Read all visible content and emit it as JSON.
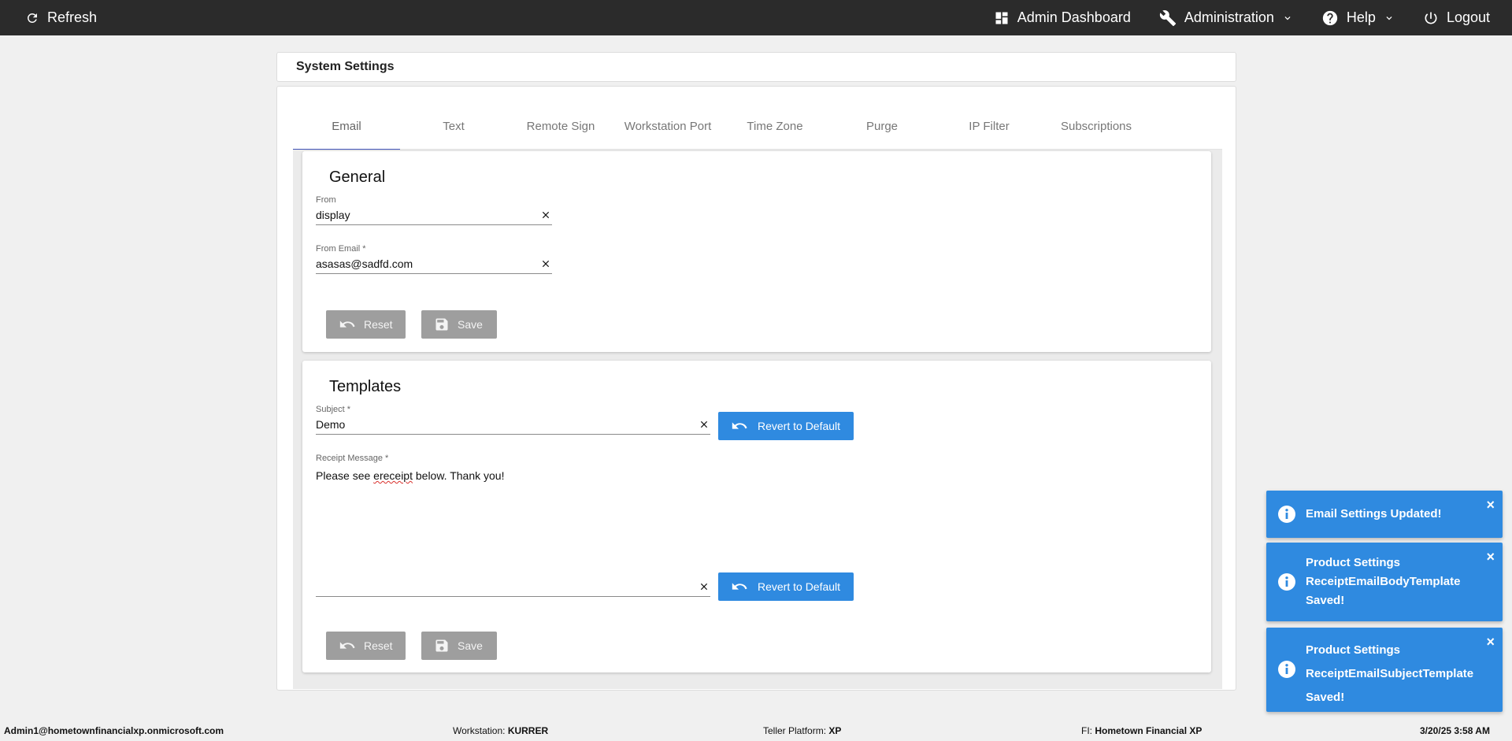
{
  "topbar": {
    "refresh_label": "Refresh",
    "admin_dashboard_label": "Admin Dashboard",
    "administration_label": "Administration",
    "help_label": "Help",
    "logout_label": "Logout"
  },
  "page": {
    "title": "System Settings"
  },
  "tabs": [
    {
      "label": "Email",
      "active": true
    },
    {
      "label": "Text"
    },
    {
      "label": "Remote Sign"
    },
    {
      "label": "Workstation Port"
    },
    {
      "label": "Time Zone"
    },
    {
      "label": "Purge"
    },
    {
      "label": "IP Filter"
    },
    {
      "label": "Subscriptions"
    }
  ],
  "general": {
    "heading": "General",
    "from_label": "From",
    "from_value": "display",
    "from_email_label": "From Email *",
    "from_email_value": "asasas@sadfd.com",
    "reset_label": "Reset",
    "save_label": "Save"
  },
  "templates": {
    "heading": "Templates",
    "subject_label": "Subject *",
    "subject_value": "Demo",
    "revert_label": "Revert to Default",
    "receipt_label": "Receipt Message *",
    "receipt_text_before": "Please see ",
    "receipt_text_misspelled": "ereceipt",
    "receipt_text_after": " below. Thank you!",
    "revert2_label": "Revert to Default",
    "reset_label": "Reset",
    "save_label": "Save"
  },
  "toasts": [
    {
      "message": "Email Settings Updated!"
    },
    {
      "message": "Product Settings ReceiptEmailBodyTemplate Saved!"
    },
    {
      "message": "Product Settings ReceiptEmailSubjectTemplate Saved!"
    }
  ],
  "toast_close": "×",
  "statusbar": {
    "user": "Admin1@hometownfinancialxp.onmicrosoft.com",
    "workstation_label": "Workstation:",
    "workstation_value": "KURRER",
    "platform_label": "Teller Platform:",
    "platform_value": "XP",
    "fi_label": "FI:",
    "fi_value": "Hometown Financial XP",
    "datetime": "3/20/25 3:58 AM"
  },
  "colors": {
    "topbar": "#2b2b2b",
    "accent_blue": "#2f8ae0",
    "tab_indicator": "#3f51b5",
    "disabled_gray": "#9e9e9e"
  }
}
